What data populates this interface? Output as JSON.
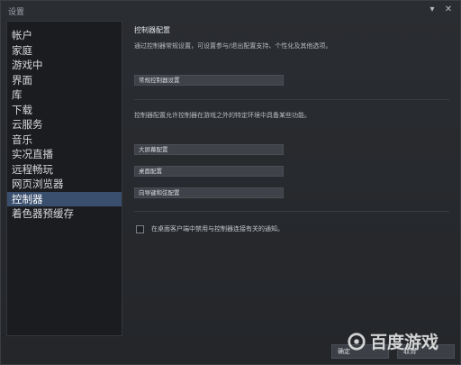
{
  "window": {
    "title": "设置",
    "minimize_glyph": "▾",
    "close_glyph": "✕"
  },
  "sidebar": {
    "items": [
      {
        "label": "帐户"
      },
      {
        "label": "家庭"
      },
      {
        "label": "游戏中"
      },
      {
        "label": "界面"
      },
      {
        "label": "库"
      },
      {
        "label": "下载"
      },
      {
        "label": "云服务"
      },
      {
        "label": "音乐"
      },
      {
        "label": "实况直播"
      },
      {
        "label": "远程畅玩"
      },
      {
        "label": "网页浏览器"
      },
      {
        "label": "控制器"
      },
      {
        "label": "着色器预缓存"
      }
    ],
    "active_index": 11
  },
  "controller": {
    "heading": "控制器配置",
    "description": "通过控制器常规设置，可设置参与/退出配置支持、个性化及其他选项。",
    "general_button": "常规控制器设置",
    "config_description": "控制器配置允许控制器在游戏之外的特定环境中具备某些功能。",
    "big_picture_button": "大屏幕配置",
    "desktop_button": "桌面配置",
    "guide_button": "向导键和弦配置",
    "notify_checkbox_label": "在桌面客户端中禁用与控制器连接有关的通知。",
    "notify_checked": false
  },
  "footer": {
    "ok_label": "确定",
    "cancel_label": "取消"
  },
  "watermark": {
    "text": "百度游戏"
  },
  "colors": {
    "active_bg": "#3a4f6e",
    "window_bg": "#26282c",
    "button_bg": "#3f4349"
  }
}
